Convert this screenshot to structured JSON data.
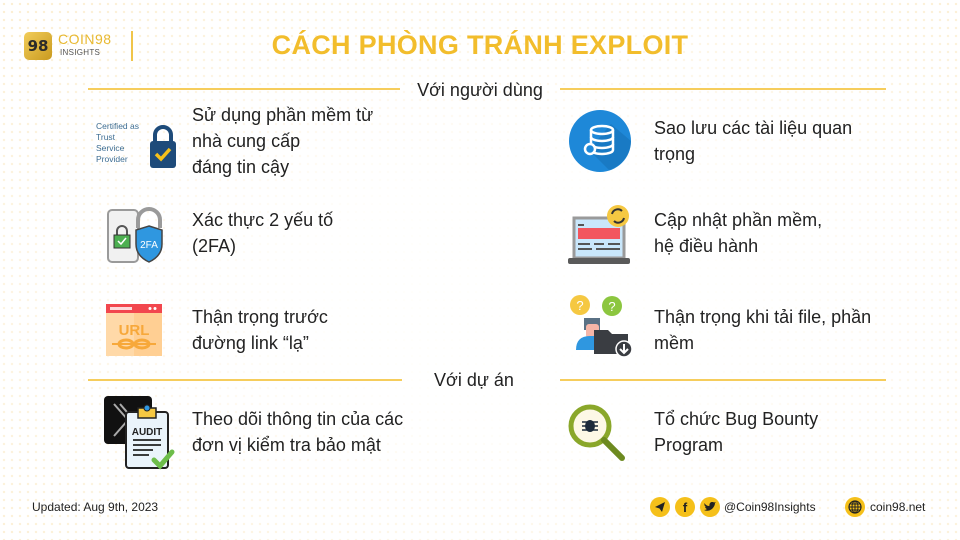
{
  "header": {
    "logo_mark": "98",
    "logo_name": "COIN98",
    "logo_sub": "INSIGHTS",
    "title": "CÁCH PHÒNG TRÁNH EXPLOIT"
  },
  "sections": [
    {
      "label": "Với người dùng",
      "left_items": [
        {
          "icon": "trust-service-provider-icon",
          "icon_text": [
            "Certified as",
            "Trust",
            "Service",
            "Provider"
          ],
          "lines": [
            "Sử dụng phần mềm từ",
            "nhà cung cấp",
            "đáng tin cậy"
          ]
        },
        {
          "icon": "two-factor-auth-icon",
          "icon_text": [
            "2FA"
          ],
          "lines": [
            "Xác thực 2 yếu tố",
            "(2FA)"
          ]
        },
        {
          "icon": "url-link-icon",
          "icon_text": [
            "URL"
          ],
          "lines": [
            "Thận trọng trước",
            "đường link “lạ”"
          ]
        }
      ],
      "right_items": [
        {
          "icon": "database-backup-icon",
          "lines": [
            "Sao lưu các tài liệu quan",
            "trọng"
          ]
        },
        {
          "icon": "laptop-update-icon",
          "lines": [
            "Cập nhật phần mềm,",
            "hệ điều hành"
          ]
        },
        {
          "icon": "file-download-caution-icon",
          "lines": [
            "Thận trọng khi tải file, phần",
            "mềm"
          ]
        }
      ]
    },
    {
      "label": "Với dự án",
      "left_items": [
        {
          "icon": "audit-icon",
          "icon_text": [
            "AUDIT"
          ],
          "lines": [
            "Theo dõi thông tin của các",
            "đơn vị kiểm tra bảo mật"
          ]
        }
      ],
      "right_items": [
        {
          "icon": "bug-bounty-magnifier-icon",
          "lines": [
            "Tổ chức Bug Bounty",
            "Program"
          ]
        }
      ]
    }
  ],
  "footer": {
    "updated": "Updated: Aug 9th, 2023",
    "social_handle": "@Coin98Insights",
    "website": "coin98.net",
    "social_icons": [
      "telegram-icon",
      "facebook-icon",
      "twitter-icon"
    ]
  },
  "colors": {
    "accent": "#f2bd2c",
    "line": "#f6cd5c",
    "text": "#222222"
  }
}
